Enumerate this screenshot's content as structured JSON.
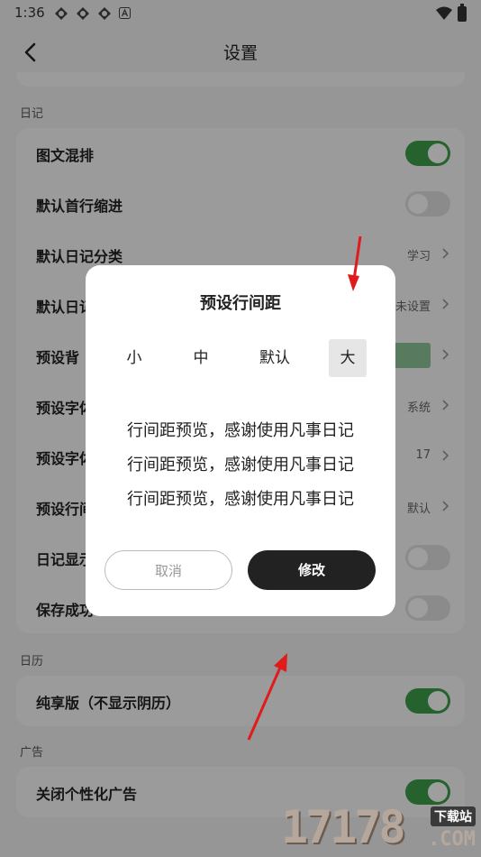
{
  "status_bar": {
    "time": "1:36"
  },
  "header": {
    "title": "设置"
  },
  "sections": {
    "diary": {
      "label": "日记",
      "rows": [
        {
          "label": "图文混排",
          "control": "toggle",
          "on": true
        },
        {
          "label": "默认首行缩进",
          "control": "toggle",
          "on": false
        },
        {
          "label": "默认日记分类",
          "value": "学习",
          "control": "chevron"
        },
        {
          "label": "默认日记",
          "value": "未设置",
          "control": "chevron"
        },
        {
          "label": "预设背",
          "control": "swatch"
        },
        {
          "label": "预设字体",
          "value": "系统",
          "control": "chevron"
        },
        {
          "label": "预设字体",
          "value": "17",
          "control": "chevron"
        },
        {
          "label": "预设行间",
          "value": "默认",
          "control": "chevron"
        },
        {
          "label": "日记显示",
          "control": "toggle",
          "on": false
        },
        {
          "label": "保存成功",
          "control": "toggle",
          "on": false
        }
      ]
    },
    "calendar": {
      "label": "日历",
      "rows": [
        {
          "label": "纯享版（不显示阴历）",
          "control": "toggle",
          "on": true
        }
      ]
    },
    "ads": {
      "label": "广告",
      "rows": [
        {
          "label": "关闭个性化广告",
          "control": "toggle",
          "on": true
        }
      ]
    }
  },
  "dialog": {
    "title": "预设行间距",
    "options": [
      "小",
      "中",
      "默认",
      "大"
    ],
    "selected_option": "大",
    "preview_lines": [
      "行间距预览，感谢使用凡事日记",
      "行间距预览，感谢使用凡事日记",
      "行间距预览，感谢使用凡事日记"
    ],
    "cancel_label": "取消",
    "confirm_label": "修改"
  },
  "watermark": {
    "number": "17178",
    "tag": "下载站",
    "domain": ".COM"
  },
  "colors": {
    "toggle_on": "#3e9e4a",
    "toggle_off": "#e0e0e0",
    "confirm_bg": "#222222",
    "arrow": "#e01b1b"
  }
}
